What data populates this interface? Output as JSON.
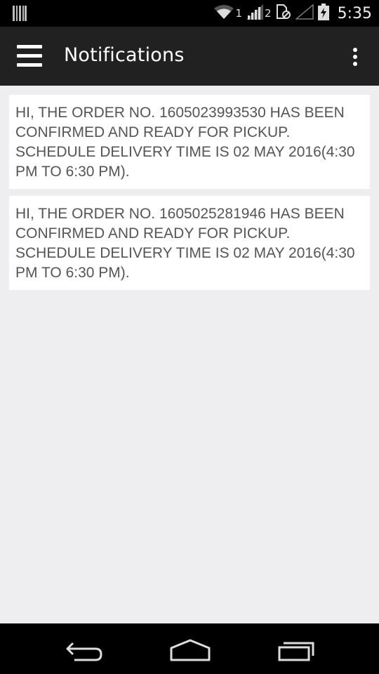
{
  "status_bar": {
    "sim1_label": "1",
    "sim2_label": "2",
    "time": "5:35"
  },
  "app_bar": {
    "title": "Notifications",
    "menu_icon": "hamburger-menu-icon",
    "overflow_icon": "more-vert-icon"
  },
  "notifications": [
    {
      "text": "HI, THE ORDER NO. 1605023993530 HAS BEEN CONFIRMED AND READY FOR PICKUP. SCHEDULE DELIVERY TIME IS 02 MAY 2016(4:30 PM TO 6:30 PM)."
    },
    {
      "text": "HI, THE ORDER NO. 1605025281946 HAS BEEN CONFIRMED AND READY FOR PICKUP. SCHEDULE DELIVERY TIME IS 02 MAY 2016(4:30 PM TO 6:30 PM)."
    }
  ],
  "nav_bar": {
    "back_icon": "back-icon",
    "home_icon": "home-icon",
    "recent_icon": "recent-apps-icon"
  },
  "colors": {
    "app_bar": "#212121",
    "content_bg": "#eeedf0",
    "card_bg": "#ffffff",
    "card_text": "#555555"
  }
}
